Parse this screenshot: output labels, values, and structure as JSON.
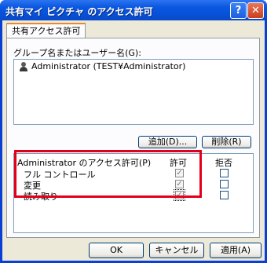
{
  "window": {
    "title": "共有マイ ピクチャ のアクセス許可",
    "help_glyph": "?",
    "close_glyph": "✕"
  },
  "tab": {
    "label": "共有アクセス許可"
  },
  "users": {
    "label": "グループ名またはユーザー名(G):",
    "items": [
      {
        "name": "Administrator (TEST¥Administrator)",
        "icon": "user-icon"
      }
    ]
  },
  "buttons": {
    "add": "追加(D)...",
    "remove": "削除(R)",
    "ok": "OK",
    "cancel": "キャンセル",
    "apply": "適用(A)"
  },
  "permissions": {
    "header_label": "Administrator のアクセス許可(P)",
    "allow_header": "許可",
    "deny_header": "拒否",
    "rows": [
      {
        "name": "フル コントロール",
        "allow": true,
        "deny": false
      },
      {
        "name": "変更",
        "allow": true,
        "deny": false
      },
      {
        "name": "読み取り",
        "allow": true,
        "deny": false
      }
    ]
  },
  "colors": {
    "highlight_frame": "#e3001b",
    "titlebar": "#0651d8"
  }
}
